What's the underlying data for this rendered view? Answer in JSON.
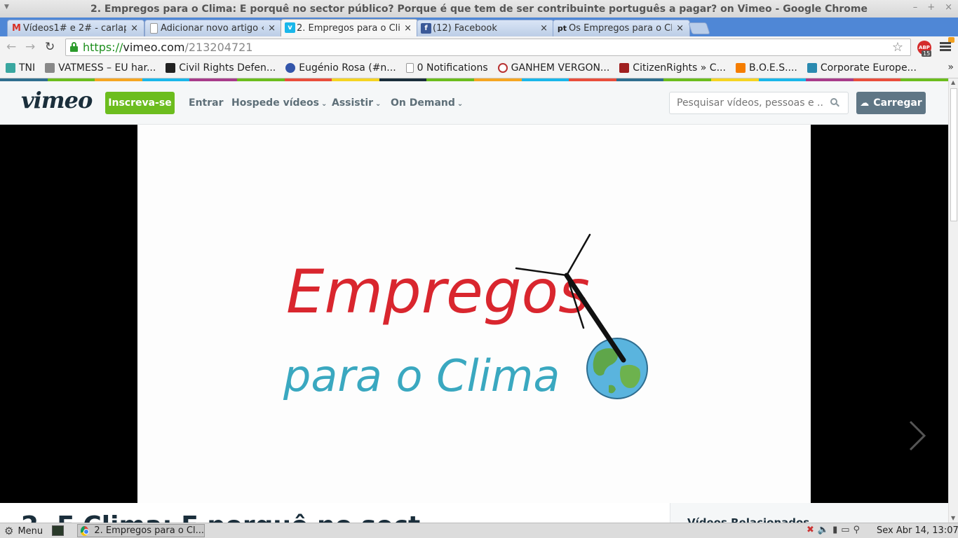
{
  "window": {
    "title": "2. Empregos para o Clima: E porquê no sector público? Porque é que tem de ser contribuinte português a pagar? on Vimeo - Google Chrome"
  },
  "tabs": [
    {
      "label": "Vídeos1# e 2# - carlap",
      "icon": "gmail-icon",
      "color": "#d93025",
      "glyph": "M"
    },
    {
      "label": "Adicionar novo artigo ‹",
      "icon": "page-icon",
      "color": "#ffffff",
      "glyph": ""
    },
    {
      "label": "2. Empregos para o Clir",
      "icon": "vimeo-icon",
      "color": "#1ab7ea",
      "glyph": "v"
    },
    {
      "label": "(12) Facebook",
      "icon": "facebook-icon",
      "color": "#3b5998",
      "glyph": "f"
    },
    {
      "label": "Os Empregos para o Cli",
      "icon": "pt-icon",
      "color": "#ffffff",
      "glyph": "pt"
    }
  ],
  "address": {
    "scheme": "https://",
    "host": "vimeo.com",
    "path": "/213204721"
  },
  "abp": {
    "label": "ABP",
    "count": "15"
  },
  "bookmarks": [
    {
      "label": "TNI",
      "icon": "tni-icon",
      "color": "#3aa7a0"
    },
    {
      "label": "VATMESS – EU har...",
      "icon": "vatmess-icon",
      "color": "#888888"
    },
    {
      "label": "Civil Rights Defen...",
      "icon": "civil-rights-icon",
      "color": "#222222"
    },
    {
      "label": "Eugénio Rosa (#n...",
      "icon": "eugenio-rosa-icon",
      "color": "#3355aa"
    },
    {
      "label": "0 Notifications",
      "icon": "page-icon",
      "color": "#ffffff"
    },
    {
      "label": "GANHEM VERGON...",
      "icon": "ganhem-icon",
      "color": "#b83232"
    },
    {
      "label": "CitizenRights » C...",
      "icon": "citizenrights-icon",
      "color": "#a02020"
    },
    {
      "label": "B.O.E.S....",
      "icon": "blogger-icon",
      "color": "#f57d00"
    },
    {
      "label": "Corporate Europe...",
      "icon": "corporate-europe-icon",
      "color": "#2a8ab0"
    }
  ],
  "bookmarks_overflow": "»",
  "colorstrip": [
    "#2f6f8f",
    "#6cbd1e",
    "#f5a623",
    "#1ab7ea",
    "#a83c8a",
    "#6cbd1e",
    "#e94e3c",
    "#f5d423",
    "#1a2e3b",
    "#6cbd1e",
    "#f5a623",
    "#1ab7ea",
    "#e94e3c",
    "#2f6f8f",
    "#6cbd1e",
    "#f5d423",
    "#1ab7ea",
    "#a83c8a",
    "#e94e3c",
    "#6cbd1e"
  ],
  "vimeo": {
    "logo": "vimeo",
    "signup_label": "Inscreva-se",
    "nav": [
      {
        "label": "Entrar",
        "dropdown": false
      },
      {
        "label": "Hospede vídeos",
        "dropdown": true
      },
      {
        "label": "Assistir",
        "dropdown": true
      },
      {
        "label": "On Demand",
        "dropdown": true
      }
    ],
    "search_placeholder": "Pesquisar vídeos, pessoas e ...",
    "upload_label": "Carregar"
  },
  "video": {
    "logo_word1": "Empregos",
    "logo_word2": "para o Clima",
    "title_partial": "2. E                           Clima: E porquê no sect",
    "related_title": "Vídeos Relacionados"
  },
  "taskbar": {
    "menu_label": "Menu",
    "task_label": "2. Empregos para o Cl...",
    "clock": "Sex Abr 14, 13:07"
  }
}
